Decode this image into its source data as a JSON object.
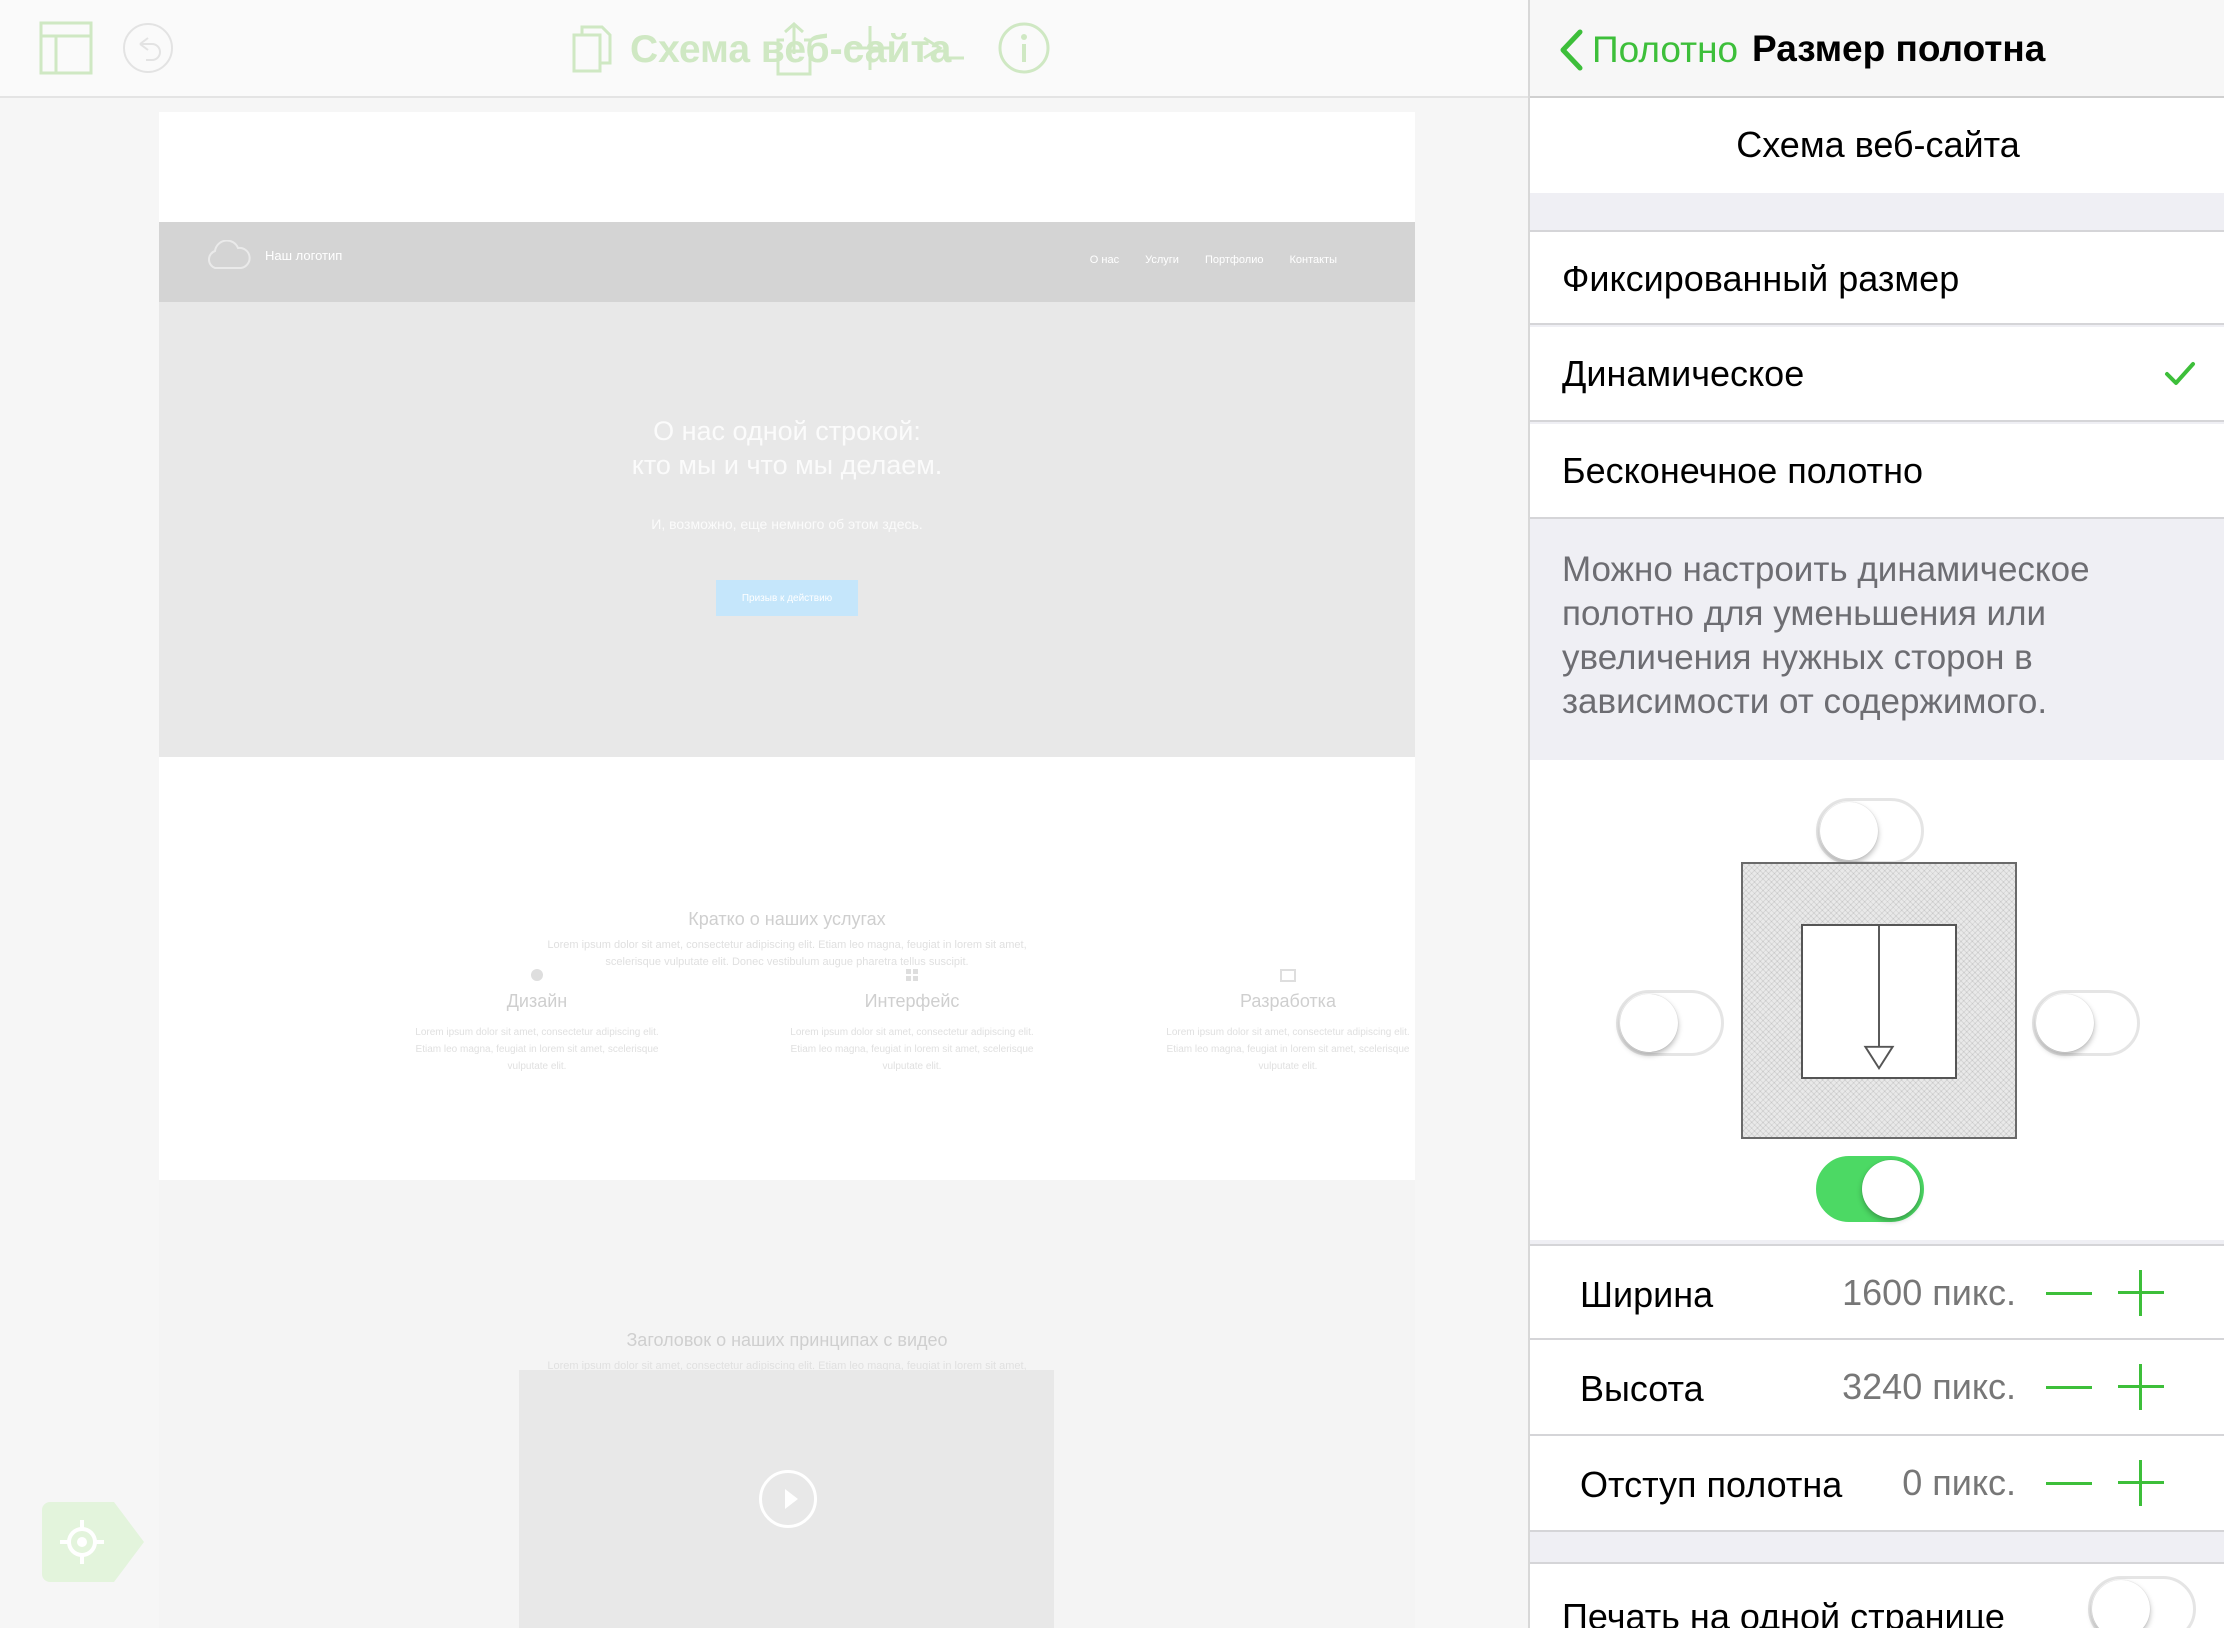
{
  "toolbar": {
    "title": "Схема веб-сайта",
    "icons": [
      "sidebar-icon",
      "undo-icon",
      "document-icon",
      "share-icon",
      "add-icon",
      "terminal-icon",
      "info-icon"
    ]
  },
  "canvas": {
    "header": {
      "logo": "Наш логотип",
      "nav": [
        "О нас",
        "Услуги",
        "Портфолио",
        "Контакты"
      ]
    },
    "hero": {
      "title_line1": "О нас одной строкой:",
      "title_line2": "кто мы и что мы делаем.",
      "subtitle": "И, возможно, еще немного об этом здесь.",
      "button": "Призыв к действию"
    },
    "services": {
      "title": "Кратко о наших услугах",
      "text": "Lorem ipsum dolor sit amet, consectetur adipiscing elit. Etiam leo magna, feugiat in lorem sit amet, scelerisque vulputate elit. Donec vestibulum augue pharetra tellus suscipit.",
      "columns": [
        {
          "title": "Дизайн",
          "text": "Lorem ipsum dolor sit amet, consectetur adipiscing elit. Etiam leo magna, feugiat in lorem sit amet, scelerisque vulputate elit."
        },
        {
          "title": "Интерфейс",
          "text": "Lorem ipsum dolor sit amet, consectetur adipiscing elit. Etiam leo magna, feugiat in lorem sit amet, scelerisque vulputate elit."
        },
        {
          "title": "Разработка",
          "text": "Lorem ipsum dolor sit amet, consectetur adipiscing elit. Etiam leo magna, feugiat in lorem sit amet, scelerisque vulputate elit."
        }
      ]
    },
    "principles": {
      "title": "Заголовок о наших принципах с видео",
      "text": "Lorem ipsum dolor sit amet, consectetur adipiscing elit. Etiam leo magna, feugiat in lorem sit amet, scelerisque vulputate elit. Donec vestibulum augue pharetra tellus suscipit."
    }
  },
  "inspector": {
    "back_label": "Полотно",
    "title": "Размер полотна",
    "document_name": "Схема веб-сайта",
    "options": [
      {
        "label": "Фиксированный размер",
        "selected": false
      },
      {
        "label": "Динамическое",
        "selected": true
      },
      {
        "label": "Бесконечное полотно",
        "selected": false
      }
    ],
    "description": "Можно настроить динамическое полотно для уменьшения или увеличения нужных сторон в зависимости от содержимого.",
    "sides": {
      "top": false,
      "left": false,
      "right": false,
      "bottom": true
    },
    "fields": [
      {
        "label": "Ширина",
        "value": "1600 пикс."
      },
      {
        "label": "Высота",
        "value": "3240 пикс."
      },
      {
        "label": "Отступ полотна",
        "value": "0 пикс."
      }
    ],
    "print_label": "Печать на одной странице",
    "print_on": false
  },
  "colors": {
    "accent": "#3dbf3a",
    "toggle_on": "#4cd964",
    "toolbar_icon": "#cfe8c3"
  }
}
